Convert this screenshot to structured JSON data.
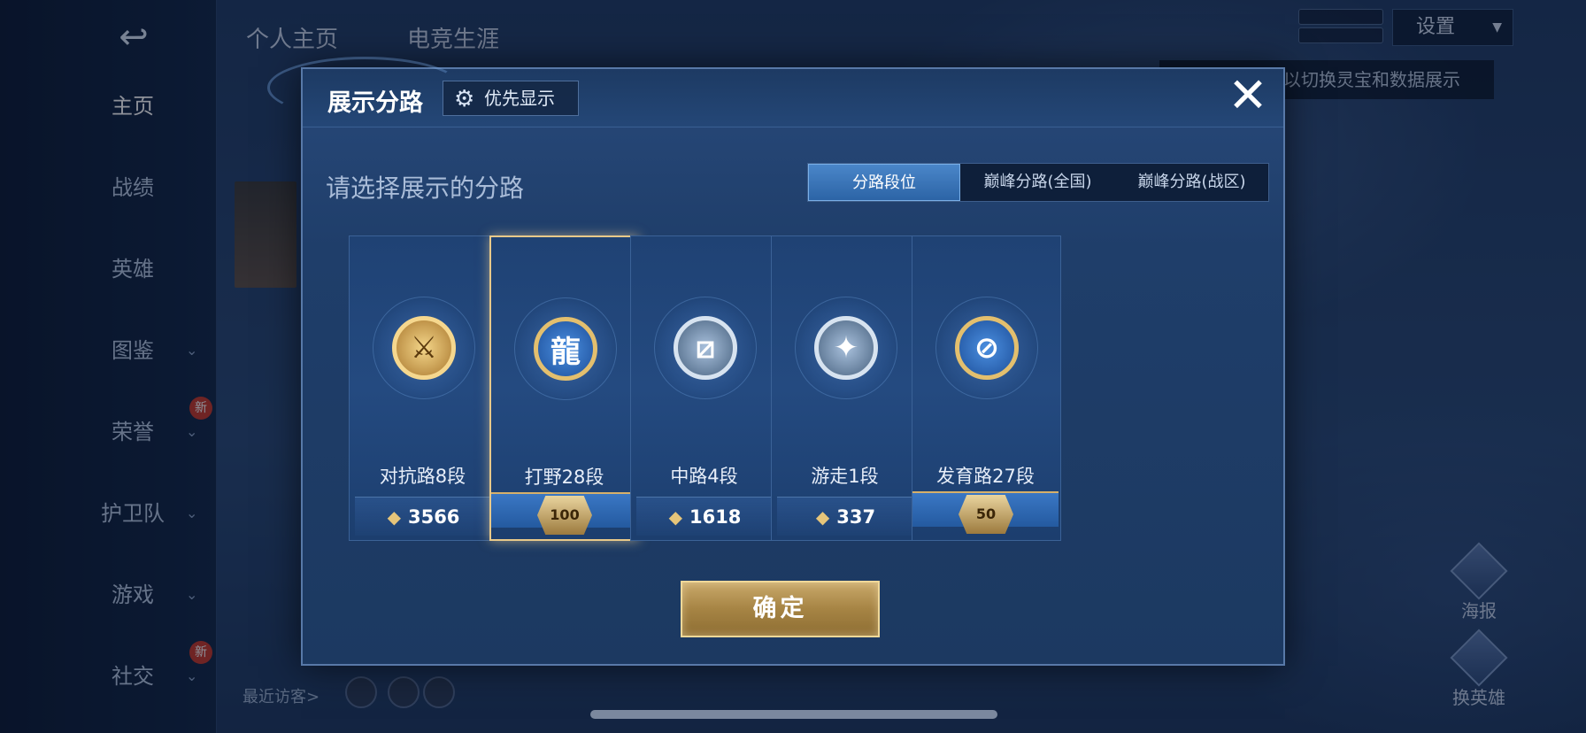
{
  "background": {
    "back_icon": "↩",
    "nav": [
      {
        "label": "主页",
        "active": true,
        "has_chevron": false
      },
      {
        "label": "战绩",
        "active": false,
        "has_chevron": false
      },
      {
        "label": "英雄",
        "active": false,
        "has_chevron": false
      },
      {
        "label": "图鉴",
        "active": false,
        "has_chevron": true
      },
      {
        "label": "荣誉",
        "active": false,
        "has_chevron": true,
        "badge": "新"
      },
      {
        "label": "护卫队",
        "active": false,
        "has_chevron": true
      },
      {
        "label": "游戏",
        "active": false,
        "has_chevron": true
      },
      {
        "label": "社交",
        "active": false,
        "has_chevron": true,
        "badge": "新"
      }
    ],
    "top_tabs": [
      "个人主页",
      "电竞生涯"
    ],
    "settings_label": "设置",
    "hint_text": "以切换灵宝和数据展示",
    "visitors_label": "最近访客>",
    "side_buttons": [
      {
        "label": "海报"
      },
      {
        "label": "换英雄"
      }
    ]
  },
  "modal": {
    "title": "展示分路",
    "priority_button": {
      "icon": "gear-icon",
      "label": "优先显示"
    },
    "close_icon": "✕",
    "prompt": "请选择展示的分路",
    "tabs": [
      {
        "label": "分路段位",
        "active": true
      },
      {
        "label": "巅峰分路(全国)",
        "active": false
      },
      {
        "label": "巅峰分路(战区)",
        "active": false
      }
    ],
    "lanes": [
      {
        "name": "对抗路8段",
        "score": "3566",
        "badge_style": "gold",
        "badge_glyph": "⚔",
        "selected": false
      },
      {
        "name": "打野28段",
        "rank": "100",
        "badge_style": "blue",
        "badge_glyph": "龍",
        "selected": true
      },
      {
        "name": "中路4段",
        "score": "1618",
        "badge_style": "silver",
        "badge_glyph": "⧄",
        "selected": false
      },
      {
        "name": "游走1段",
        "score": "337",
        "badge_style": "silver",
        "badge_glyph": "✦",
        "selected": false
      },
      {
        "name": "发育路27段",
        "rank": "50",
        "badge_style": "blue",
        "badge_glyph": "⊘",
        "selected": false
      }
    ],
    "score_icon": "◆",
    "confirm_label": "确定"
  }
}
